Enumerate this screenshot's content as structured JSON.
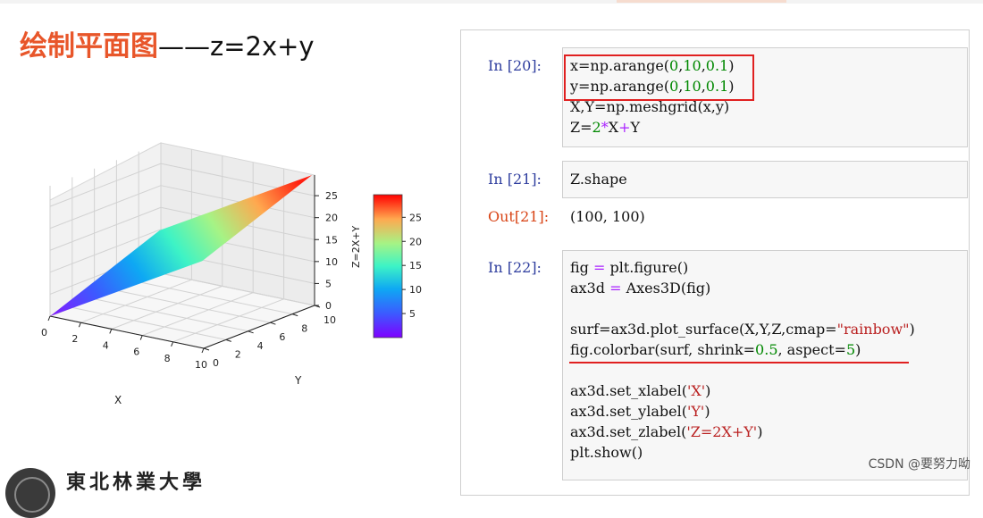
{
  "slide": {
    "title_cn": "绘制平面图",
    "title_sep": "——",
    "title_eq": "z=2x+y",
    "school_name": "東北林業大學"
  },
  "plot3d": {
    "x_label": "X",
    "y_label": "Y",
    "z_label": "Z=2X+Y",
    "x_ticks": [
      "0",
      "2",
      "4",
      "6",
      "8",
      "10"
    ],
    "y_ticks": [
      "0",
      "2",
      "4",
      "6",
      "8",
      "10"
    ],
    "z_ticks": [
      "0",
      "5",
      "10",
      "15",
      "20",
      "25"
    ],
    "colorbar_ticks": [
      "5",
      "10",
      "15",
      "20",
      "25"
    ],
    "colormap": "rainbow"
  },
  "chart_data": {
    "type": "surface",
    "function": "Z=2X+Y",
    "x_range": [
      0,
      10
    ],
    "y_range": [
      0,
      10
    ],
    "z_range": [
      0,
      29.7
    ],
    "corners": [
      {
        "x": 0,
        "y": 0,
        "z": 0
      },
      {
        "x": 9.9,
        "y": 0,
        "z": 19.8
      },
      {
        "x": 0,
        "y": 9.9,
        "z": 9.9
      },
      {
        "x": 9.9,
        "y": 9.9,
        "z": 29.7
      }
    ],
    "colorbar_range": [
      0,
      29.7
    ]
  },
  "notebook": {
    "cells": [
      {
        "prompt": "In [20]:",
        "lines": [
          "x=np.arange(0,10,0.1)",
          "y=np.arange(0,10,0.1)",
          "X,Y=np.meshgrid(x,y)",
          "Z=2*X+Y"
        ]
      },
      {
        "prompt": "In [21]:",
        "lines": [
          "Z.shape"
        ]
      },
      {
        "prompt": "Out[21]:",
        "lines": [
          "(100, 100)"
        ]
      },
      {
        "prompt": "In [22]:",
        "lines": [
          "fig = plt.figure()",
          "ax3d = Axes3D(fig)",
          "",
          "surf=ax3d.plot_surface(X,Y,Z,cmap=\"rainbow\")",
          "fig.colorbar(surf, shrink=0.5, aspect=5)",
          "",
          "ax3d.set_xlabel('X')",
          "ax3d.set_ylabel('Y')",
          "ax3d.set_zlabel('Z=2X+Y')",
          "plt.show()"
        ]
      }
    ]
  },
  "watermark": "CSDN @要努力呦",
  "colors": {
    "title_accent": "#e8562a",
    "highlight_box": "#e02020",
    "prompt_in": "#303f9f",
    "prompt_out": "#d84315"
  }
}
